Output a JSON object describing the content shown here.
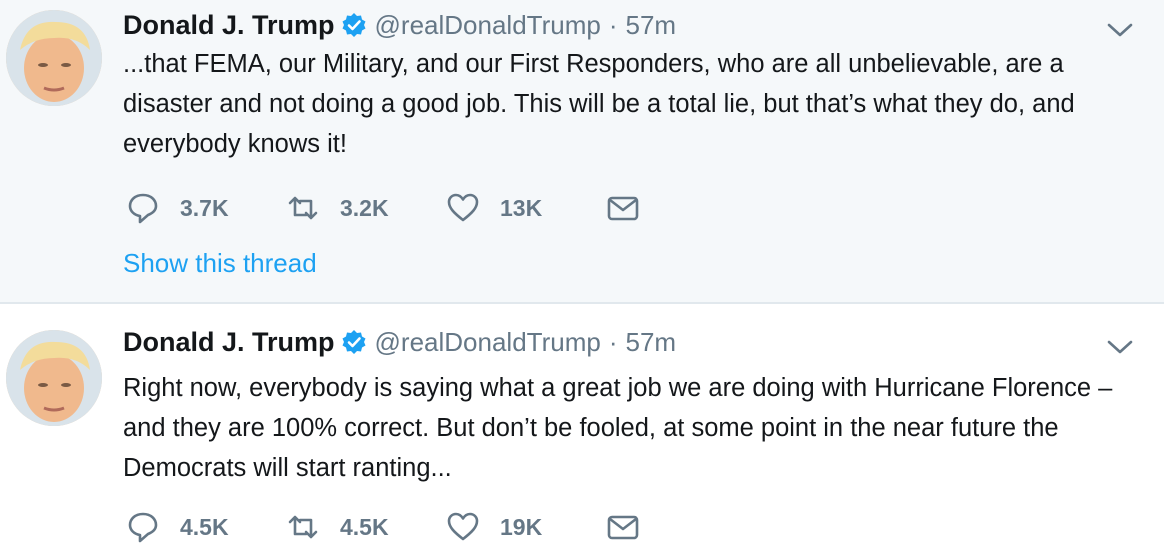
{
  "tweets": [
    {
      "name": "Donald J. Trump",
      "handle": "@realDonaldTrump",
      "separator": "·",
      "time": "57m",
      "text": "...that FEMA, our Military, and our First Responders, who are all unbelievable, are a disaster and not doing a good job. This will be a total lie, but that’s what they do, and everybody knows it!",
      "replies": "3.7K",
      "retweets": "3.2K",
      "likes": "13K",
      "thread_link": "Show this thread"
    },
    {
      "name": "Donald J. Trump",
      "handle": "@realDonaldTrump",
      "separator": "·",
      "time": "57m",
      "text": "Right now, everybody is saying what a great job we are doing with Hurricane Florence – and they are 100% correct. But don’t be fooled, at some point in the near future the Democrats will start ranting...",
      "replies": "4.5K",
      "retweets": "4.5K",
      "likes": "19K"
    }
  ],
  "icons": {
    "verified": "verified-badge-icon",
    "caret": "chevron-down-icon",
    "reply": "reply-icon",
    "retweet": "retweet-icon",
    "like": "heart-icon",
    "message": "envelope-icon"
  },
  "colors": {
    "link": "#1da1f2",
    "muted": "#657786",
    "text": "#14171a",
    "highlight_bg": "#f5f8fa"
  }
}
